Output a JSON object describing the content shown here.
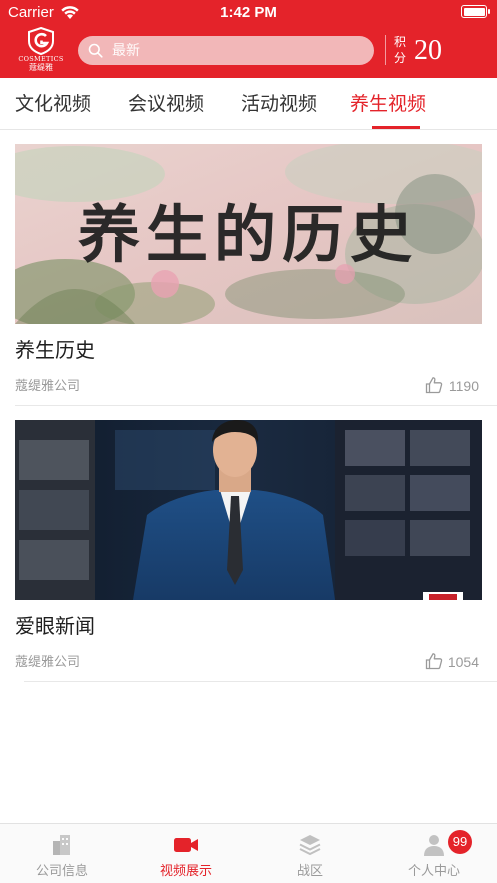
{
  "status_bar": {
    "carrier": "Carrier",
    "time": "1:42 PM"
  },
  "header": {
    "logo_en": "COSMETICS",
    "logo_cn": "蔻缇雅",
    "search_placeholder": "最新",
    "points_label": "积分",
    "points_value": "20"
  },
  "tabs": [
    {
      "label": "文化视频",
      "active": false
    },
    {
      "label": "会议视频",
      "active": false
    },
    {
      "label": "活动视频",
      "active": false
    },
    {
      "label": "养生视频",
      "active": true
    }
  ],
  "videos": [
    {
      "title": "养生历史",
      "source": "蔻缇雅公司",
      "likes": "1190",
      "thumb_text": "养生的历史"
    },
    {
      "title": "爱眼新闻",
      "source": "蔻缇雅公司",
      "likes": "1054"
    }
  ],
  "tabbar": [
    {
      "label": "公司信息",
      "icon": "building-icon",
      "active": false
    },
    {
      "label": "视频展示",
      "icon": "video-camera-icon",
      "active": true
    },
    {
      "label": "战区",
      "icon": "layers-icon",
      "active": false
    },
    {
      "label": "个人中心",
      "icon": "person-icon",
      "active": false,
      "badge": "99"
    }
  ],
  "colors": {
    "brand": "#e4232a",
    "search_bg": "#f2b7b8",
    "muted_text": "#9a9a9a"
  }
}
